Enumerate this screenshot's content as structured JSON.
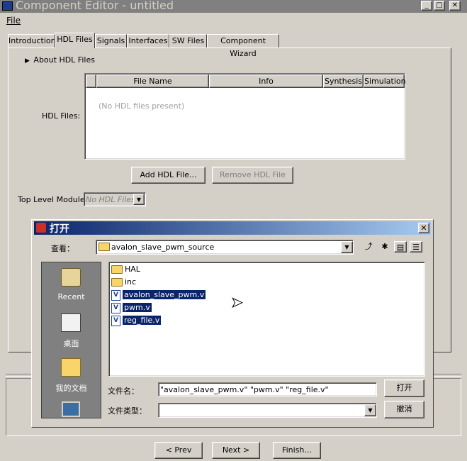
{
  "window": {
    "title": "Component Editor - untitled"
  },
  "menu": {
    "file": "File"
  },
  "tabs": [
    "Introduction",
    "HDL Files",
    "Signals",
    "Interfaces",
    "SW Files",
    "Component Wizard"
  ],
  "hdl": {
    "about": "About HDL Files",
    "files_label": "HDL Files:",
    "columns": [
      "File Name",
      "Info",
      "Synthesis",
      "Simulation"
    ],
    "empty": "(No HDL files present)",
    "add_button": "Add HDL File...",
    "remove_button": "Remove HDL File",
    "top_level_label": "Top Level Module:",
    "top_level_value": "No HDL Files"
  },
  "dialog": {
    "title": "打开",
    "lookin_label": "查看：",
    "lookin_value": "avalon_slave_pwm_source",
    "places": [
      "Recent",
      "桌面",
      "我的文档"
    ],
    "files": [
      {
        "name": "HAL",
        "type": "folder",
        "selected": false
      },
      {
        "name": "inc",
        "type": "folder",
        "selected": false
      },
      {
        "name": "avalon_slave_pwm.v",
        "type": "verilog",
        "selected": true
      },
      {
        "name": "pwm.v",
        "type": "verilog",
        "selected": true
      },
      {
        "name": "reg_file.v",
        "type": "verilog",
        "selected": true
      }
    ],
    "filename_label": "文件名：",
    "filename_value": "\"avalon_slave_pwm.v\" \"pwm.v\" \"reg_file.v\"",
    "filetype_label": "文件类型：",
    "filetype_value": "",
    "open_button": "打开",
    "cancel_button": "撤消"
  },
  "footer": {
    "prev": "< Prev",
    "next": "Next >",
    "finish": "Finish..."
  }
}
